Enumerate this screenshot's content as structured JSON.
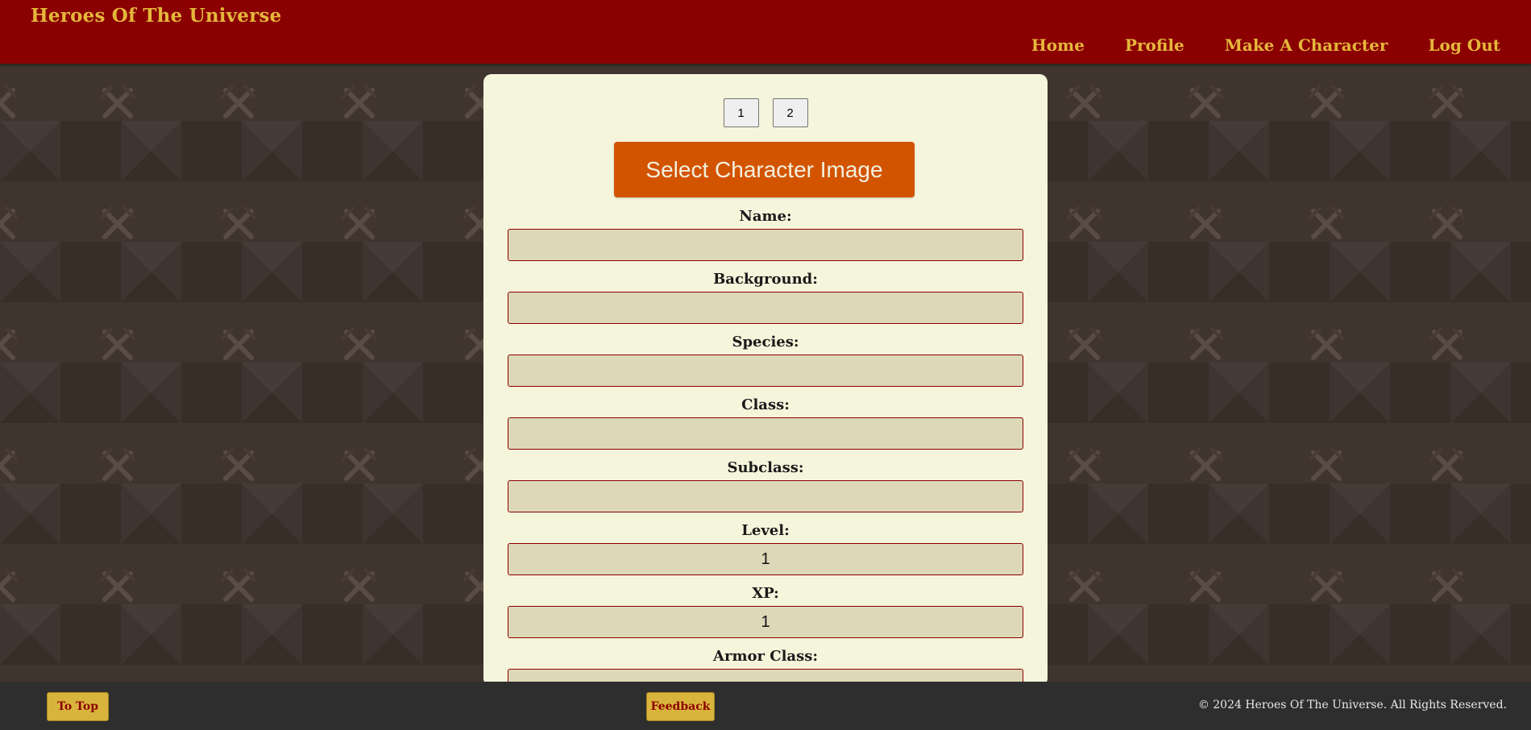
{
  "header": {
    "brand": "Heroes Of The Universe",
    "nav": [
      "Home",
      "Profile",
      "Make A Character",
      "Log Out"
    ]
  },
  "pager": {
    "pages": [
      "1",
      "2"
    ]
  },
  "form": {
    "select_image_label": "Select Character Image",
    "fields": [
      {
        "label": "Name:",
        "value": ""
      },
      {
        "label": "Background:",
        "value": ""
      },
      {
        "label": "Species:",
        "value": ""
      },
      {
        "label": "Class:",
        "value": ""
      },
      {
        "label": "Subclass:",
        "value": ""
      },
      {
        "label": "Level:",
        "value": "1"
      },
      {
        "label": "XP:",
        "value": "1"
      },
      {
        "label": "Armor Class:",
        "value": ""
      }
    ]
  },
  "footer": {
    "to_top": "To Top",
    "feedback": "Feedback",
    "copyright": "© 2024 Heroes Of The Universe. All Rights Reserved."
  },
  "colors": {
    "header_bg": "#8b0000",
    "accent_gold": "#e5b73b",
    "card_bg": "#f5f5dc",
    "button_orange": "#d35400",
    "input_bg": "#ddd8b8",
    "footer_bg": "#2e2e2e"
  },
  "icons": {
    "background_pattern": "crossed-swords-icon"
  }
}
